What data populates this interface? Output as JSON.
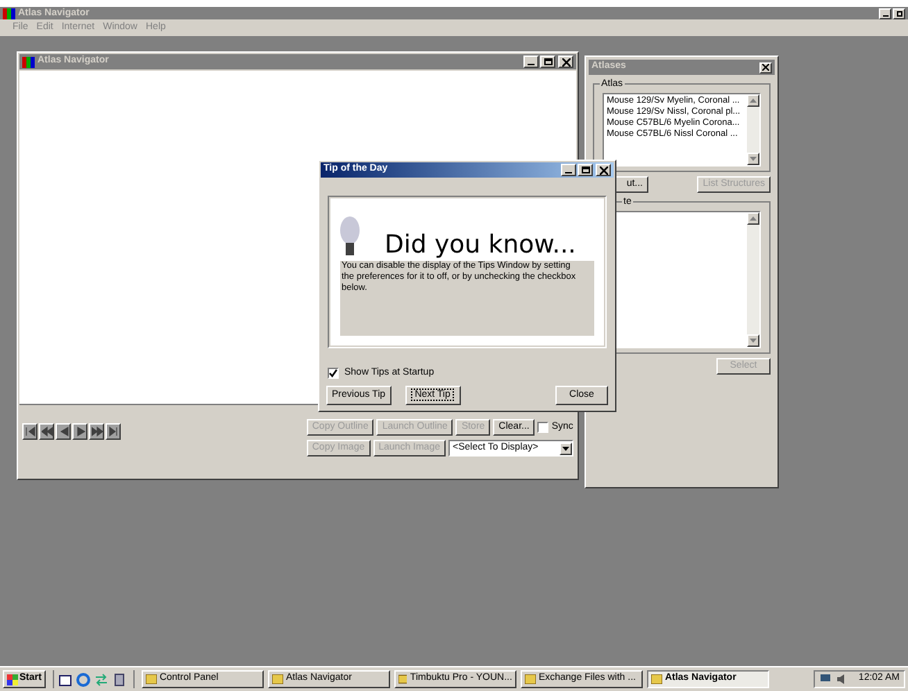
{
  "app": {
    "title": "Atlas Navigator",
    "menu": [
      "File",
      "Edit",
      "Internet",
      "Window",
      "Help"
    ]
  },
  "navigator": {
    "title": "Atlas Navigator",
    "actions_row1": [
      {
        "label": "Copy Outline",
        "disabled": true
      },
      {
        "label": "Launch Outline",
        "disabled": true
      },
      {
        "label": "Store",
        "disabled": true
      },
      {
        "label": "Clear...",
        "disabled": false
      }
    ],
    "sync": {
      "label": "Sync",
      "checked": false
    },
    "actions_row2": [
      {
        "label": "Copy Image",
        "disabled": true
      },
      {
        "label": "Launch Image",
        "disabled": true
      }
    ],
    "display_select": {
      "value": "<Select To Display>"
    }
  },
  "atlases": {
    "title": "Atlases",
    "atlas_group": "Atlas",
    "atlas_items": [
      "Mouse 129/Sv Myelin, Coronal ...",
      "Mouse 129/Sv Nissl, Coronal pl...",
      "Mouse C57BL/6 Myelin Corona...",
      "Mouse C57BL/6 Nissl Coronal ..."
    ],
    "buttons": [
      {
        "label": "ut...",
        "disabled": false
      },
      {
        "label": "List Structures",
        "disabled": true
      }
    ],
    "second_group": "te",
    "select_button": {
      "label": "Select",
      "disabled": true
    }
  },
  "tip": {
    "title": "Tip of the Day",
    "heading": "Did you know...",
    "body": "You can disable the display of the Tips Window by setting the preferences for it to off, or by unchecking the checkbox below.",
    "show_at_startup": {
      "label": "Show Tips at Startup",
      "checked": true
    },
    "buttons": [
      {
        "label": "Previous Tip",
        "focused": false
      },
      {
        "label": "Next Tip",
        "focused": true
      },
      {
        "label": "Close",
        "focused": false
      }
    ]
  },
  "taskbar": {
    "start": "Start",
    "tasks": [
      {
        "label": "Control Panel",
        "selected": false
      },
      {
        "label": "Atlas Navigator",
        "selected": false
      },
      {
        "label": "Timbuktu Pro - YOUN...",
        "selected": false
      },
      {
        "label": "Exchange Files with ...",
        "selected": false
      },
      {
        "label": "Atlas Navigator",
        "selected": true
      }
    ],
    "clock": "12:02 AM"
  }
}
